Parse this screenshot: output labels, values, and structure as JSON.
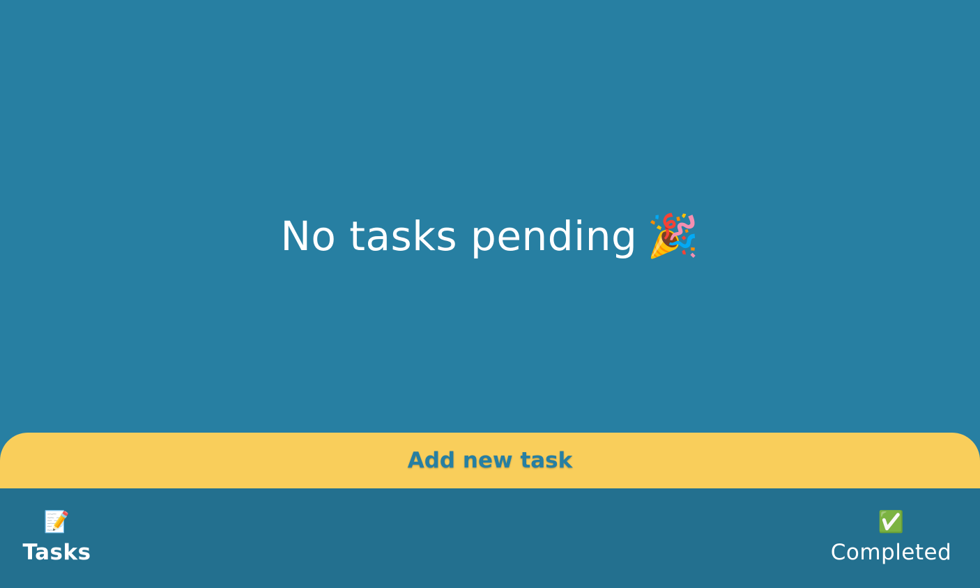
{
  "main": {
    "empty_message": "No tasks pending",
    "empty_icon": "🎉",
    "empty_icon_name": "party-popper-icon"
  },
  "add_task": {
    "label": "Add new task"
  },
  "nav": {
    "items": [
      {
        "label": "Tasks",
        "icon": "📝",
        "icon_name": "memo-icon",
        "active": true
      },
      {
        "label": "Completed",
        "icon": "✅",
        "icon_name": "check-mark-icon",
        "active": false
      }
    ]
  },
  "colors": {
    "background": "#277fa2",
    "accent": "#f9ce5b",
    "nav_background": "#23708f",
    "text": "#ffffff"
  }
}
